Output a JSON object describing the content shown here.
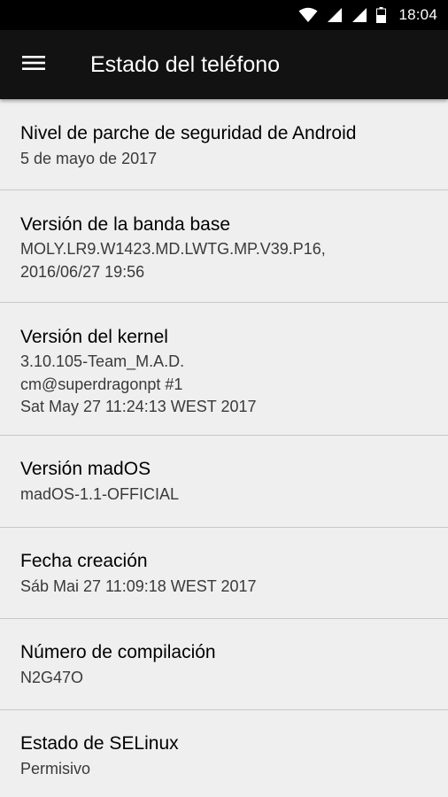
{
  "status_bar": {
    "time": "18:04",
    "icons": [
      "wifi-icon",
      "signal-icon",
      "signal-icon",
      "battery-icon"
    ]
  },
  "app_bar": {
    "menu_icon": "hamburger-menu-icon",
    "title": "Estado del teléfono"
  },
  "items": [
    {
      "title": "Nivel de parche de seguridad de Android",
      "summary": [
        "5 de mayo de 2017"
      ]
    },
    {
      "title": "Versión de la banda base",
      "summary": [
        "MOLY.LR9.W1423.MD.LWTG.MP.V39.P16,",
        "2016/06/27 19:56"
      ]
    },
    {
      "title": "Versión del kernel",
      "summary": [
        "3.10.105-Team_M.A.D.",
        "cm@superdragonpt #1",
        "Sat May 27 11:24:13 WEST 2017"
      ]
    },
    {
      "title": "Versión madOS",
      "summary": [
        "madOS-1.1-OFFICIAL"
      ]
    },
    {
      "title": "Fecha creación",
      "summary": [
        "Sáb Mai 27 11:09:18 WEST 2017"
      ]
    },
    {
      "title": "Número de compilación",
      "summary": [
        "N2G47O"
      ]
    },
    {
      "title": "Estado de SELinux",
      "summary": [
        "Permisivo"
      ]
    }
  ],
  "colors": {
    "status_bar": "#000000",
    "app_bar": "#121212",
    "background": "#efefef",
    "divider": "#c8c8c8"
  }
}
